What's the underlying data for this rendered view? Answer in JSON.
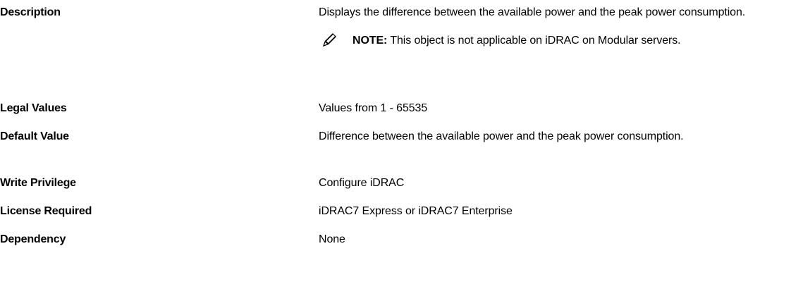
{
  "rows": [
    {
      "label": "Description",
      "value": "Displays the difference between the available power and the peak power consumption.",
      "note": {
        "icon": "note-pencil-icon",
        "label": "NOTE:",
        "text": " This object is not applicable on iDRAC on Modular servers."
      }
    },
    {
      "label": "Legal Values",
      "value": "Values from 1 - 65535"
    },
    {
      "label": "Default Value",
      "value": "Difference between the available power and the peak power consumption."
    },
    {
      "label": "Write Privilege",
      "value": "Configure iDRAC"
    },
    {
      "label": "License Required",
      "value": "iDRAC7 Express or iDRAC7 Enterprise"
    },
    {
      "label": "Dependency",
      "value": "None"
    }
  ]
}
